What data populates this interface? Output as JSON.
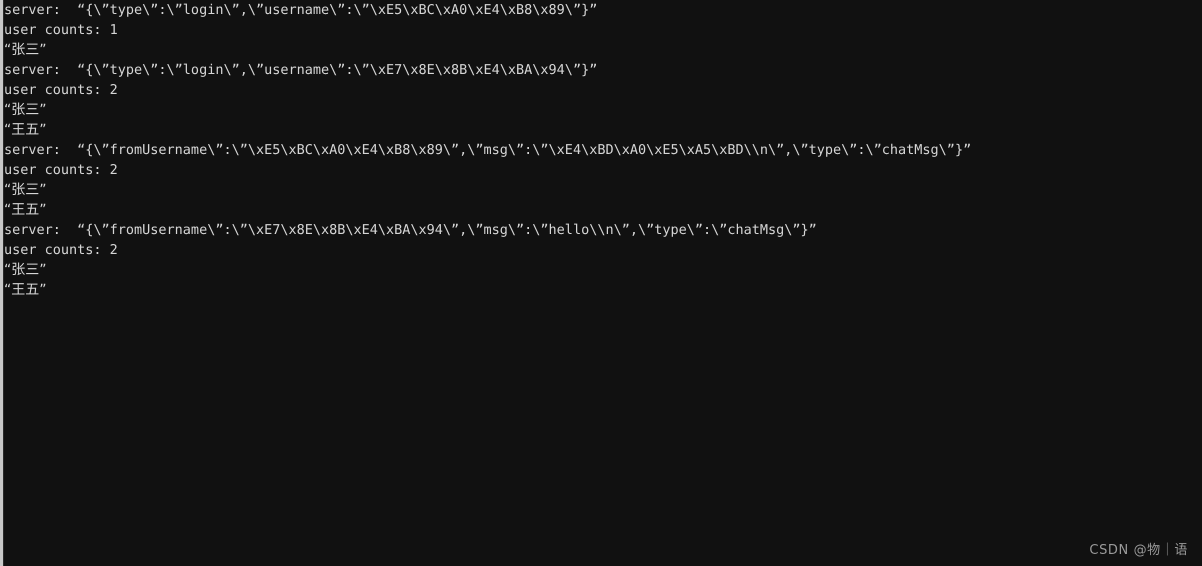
{
  "window": {
    "type": "terminal-console-output",
    "background_color": "#111111",
    "text_color": "#d6d6d6",
    "gutter_color": "#c8c8c8"
  },
  "console": {
    "lines": [
      {
        "id": "line-1",
        "kind": "server-message",
        "text": "server:  “{\\”type\\”:\\”login\\”,\\”username\\”:\\”\\xE5\\xBC\\xA0\\xE4\\xB8\\x89\\”}”"
      },
      {
        "id": "line-2",
        "kind": "user-count",
        "text": "user counts: 1"
      },
      {
        "id": "line-3",
        "kind": "username",
        "text": "“张三”"
      },
      {
        "id": "line-4",
        "kind": "server-message",
        "text": "server:  “{\\”type\\”:\\”login\\”,\\”username\\”:\\”\\xE7\\x8E\\x8B\\xE4\\xBA\\x94\\”}”"
      },
      {
        "id": "line-5",
        "kind": "user-count",
        "text": "user counts: 2"
      },
      {
        "id": "line-6",
        "kind": "username",
        "text": "“张三”"
      },
      {
        "id": "line-7",
        "kind": "username",
        "text": "“王五”"
      },
      {
        "id": "line-8",
        "kind": "server-message",
        "text": "server:  “{\\”fromUsername\\”:\\”\\xE5\\xBC\\xA0\\xE4\\xB8\\x89\\”,\\”msg\\”:\\”\\xE4\\xBD\\xA0\\xE5\\xA5\\xBD\\\\n\\”,\\”type\\”:\\”chatMsg\\”}”"
      },
      {
        "id": "line-9",
        "kind": "user-count",
        "text": "user counts: 2"
      },
      {
        "id": "line-10",
        "kind": "username",
        "text": "“张三”"
      },
      {
        "id": "line-11",
        "kind": "username",
        "text": "“王五”"
      },
      {
        "id": "line-12",
        "kind": "server-message",
        "text": "server:  “{\\”fromUsername\\”:\\”\\xE7\\x8E\\x8B\\xE4\\xBA\\x94\\”,\\”msg\\”:\\”hello\\\\n\\”,\\”type\\”:\\”chatMsg\\”}”"
      },
      {
        "id": "line-13",
        "kind": "user-count",
        "text": "user counts: 2"
      },
      {
        "id": "line-14",
        "kind": "username",
        "text": "“张三”"
      },
      {
        "id": "line-15",
        "kind": "username",
        "text": "“王五”"
      }
    ]
  },
  "watermark": {
    "text": "CSDN @物｜语"
  }
}
